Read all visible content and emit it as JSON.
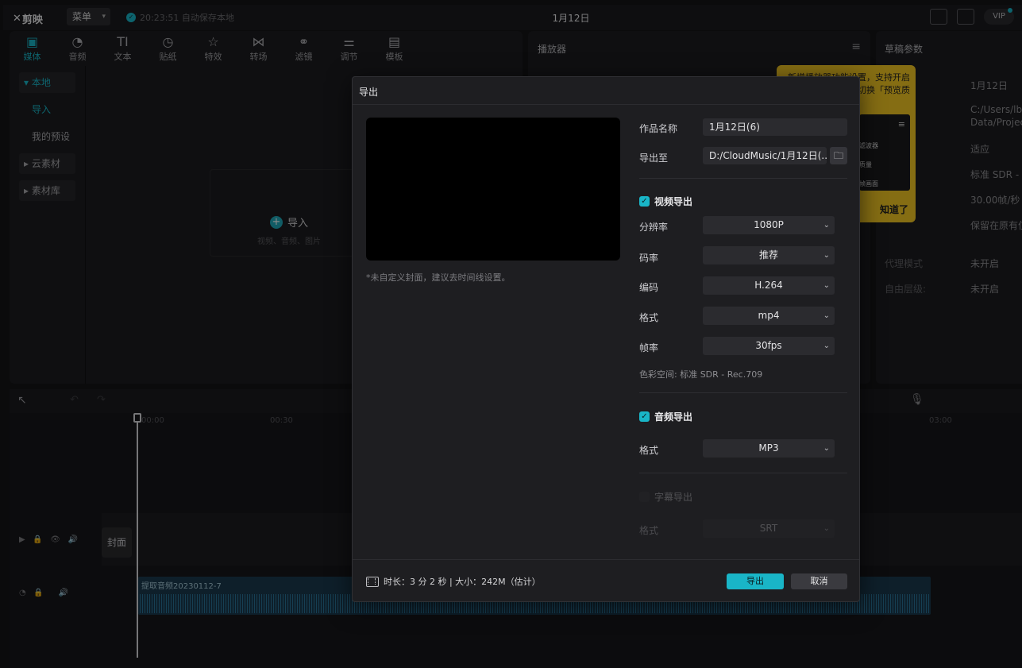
{
  "app": {
    "logo_text": "剪映",
    "menu_label": "菜单",
    "autosave_text": "20:23:51 自动保存本地",
    "project_title": "1月12日",
    "vip_label": "VIP"
  },
  "media_toolbar": [
    {
      "label": "媒体",
      "icon": "media-icon"
    },
    {
      "label": "音频",
      "icon": "audio-icon"
    },
    {
      "label": "文本",
      "icon": "text-icon"
    },
    {
      "label": "贴纸",
      "icon": "sticker-icon"
    },
    {
      "label": "特效",
      "icon": "effects-icon"
    },
    {
      "label": "转场",
      "icon": "transition-icon"
    },
    {
      "label": "滤镜",
      "icon": "filter-icon"
    },
    {
      "label": "调节",
      "icon": "adjust-icon"
    },
    {
      "label": "模板",
      "icon": "template-icon"
    }
  ],
  "sidebar": {
    "local": "本地",
    "import": "导入",
    "my_presets": "我的预设",
    "cloud": "云素材",
    "library": "素材库"
  },
  "import_area": {
    "label": "导入",
    "sub": "视频、音频、图片"
  },
  "player": {
    "title": "播放器"
  },
  "draft": {
    "title": "草稿参数",
    "values": [
      "1月12日",
      "C:/Users/lb",
      "Data/Projec",
      "适应",
      "标准 SDR -",
      "30.00帧/秒",
      "保留在原有位"
    ],
    "proxy_label": "代理模式",
    "proxy_value": "未开启",
    "layer_label": "自由层级:",
    "layer_value": "未开启"
  },
  "tooltip": {
    "text": "新增播放器功能设置，支持开启切换「预览质",
    "menu_items": [
      "滤波器",
      "质量",
      "帧画面"
    ],
    "ok": "知道了"
  },
  "timeline": {
    "ruler_marks": [
      "00:00",
      "00:30",
      "03:00"
    ],
    "cover_label": "封面",
    "audio_clip_name": "提取音频20230112-7"
  },
  "export_dialog": {
    "title": "导出",
    "cover_hint": "*未自定义封面，建议去时间线设置。",
    "name_label": "作品名称",
    "name_value": "1月12日(6)",
    "path_label": "导出至",
    "path_value": "D:/CloudMusic/1月12日(...",
    "video_section": "视频导出",
    "resolution_label": "分辨率",
    "resolution_value": "1080P",
    "bitrate_label": "码率",
    "bitrate_value": "推荐",
    "codec_label": "编码",
    "codec_value": "H.264",
    "format_label": "格式",
    "format_value": "mp4",
    "fps_label": "帧率",
    "fps_value": "30fps",
    "colorspace": "色彩空间:  标准 SDR - Rec.709",
    "audio_section": "音频导出",
    "audio_format_label": "格式",
    "audio_format_value": "MP3",
    "subtitle_section": "字幕导出",
    "subtitle_format_label": "格式",
    "subtitle_format_value": "SRT",
    "footer_info": "时长：3 分 2 秒 | 大小：242M（估计）",
    "export_button": "导出",
    "cancel_button": "取消"
  }
}
